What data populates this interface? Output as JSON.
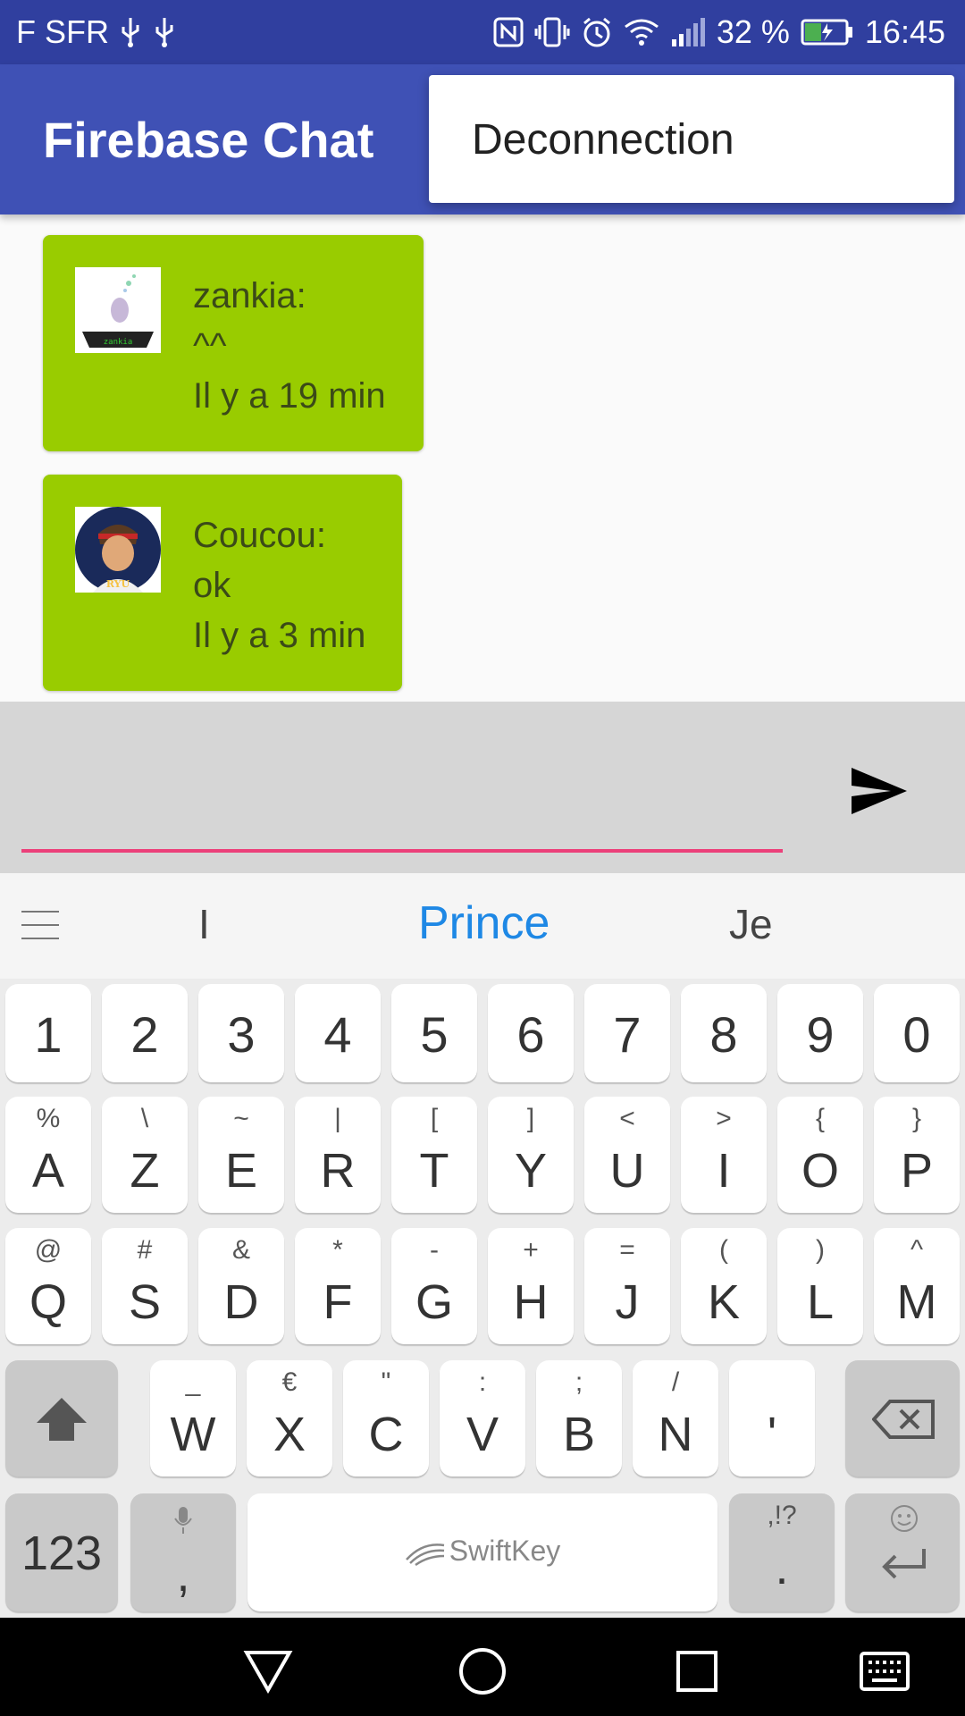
{
  "status_bar": {
    "carrier": "F SFR",
    "battery": "32 %",
    "time": "16:45",
    "icons": [
      "usb-icon",
      "usb-icon",
      "nfc-icon",
      "vibrate-icon",
      "alarm-icon",
      "wifi-icon",
      "signal-icon",
      "battery-icon"
    ]
  },
  "app_bar": {
    "title": "Firebase Chat"
  },
  "overflow_menu": {
    "items": [
      {
        "label": "Deconnection"
      }
    ]
  },
  "messages": [
    {
      "author": "zankia:",
      "text": "^^",
      "time": "Il y a 19 min",
      "avatar": "zankia-avatar"
    },
    {
      "author": "Coucou:",
      "text": "ok",
      "time": "Il y a 3 min",
      "avatar": "ryu-avatar"
    }
  ],
  "input": {
    "value": "",
    "placeholder": ""
  },
  "colors": {
    "primary": "#3f51b5",
    "primary_dark": "#303f9f",
    "message_bg": "#99cc00",
    "accent": "#ec407a"
  },
  "keyboard": {
    "suggestions": [
      "I",
      "Prince",
      "Je"
    ],
    "row_numbers": [
      "1",
      "2",
      "3",
      "4",
      "5",
      "6",
      "7",
      "8",
      "9",
      "0"
    ],
    "row1": [
      {
        "k": "A",
        "a": "%"
      },
      {
        "k": "Z",
        "a": "\\"
      },
      {
        "k": "E",
        "a": "~"
      },
      {
        "k": "R",
        "a": "|"
      },
      {
        "k": "T",
        "a": "["
      },
      {
        "k": "Y",
        "a": "]"
      },
      {
        "k": "U",
        "a": "<"
      },
      {
        "k": "I",
        "a": ">"
      },
      {
        "k": "O",
        "a": "{"
      },
      {
        "k": "P",
        "a": "}"
      }
    ],
    "row2": [
      {
        "k": "Q",
        "a": "@"
      },
      {
        "k": "S",
        "a": "#"
      },
      {
        "k": "D",
        "a": "&"
      },
      {
        "k": "F",
        "a": "*"
      },
      {
        "k": "G",
        "a": "-"
      },
      {
        "k": "H",
        "a": "+"
      },
      {
        "k": "J",
        "a": "="
      },
      {
        "k": "K",
        "a": "("
      },
      {
        "k": "L",
        "a": ")"
      },
      {
        "k": "M",
        "a": "^"
      }
    ],
    "row3": [
      {
        "k": "W",
        "a": "_"
      },
      {
        "k": "X",
        "a": "€"
      },
      {
        "k": "C",
        "a": "\""
      },
      {
        "k": "V",
        "a": ":"
      },
      {
        "k": "B",
        "a": ";"
      },
      {
        "k": "N",
        "a": "/"
      },
      {
        "k": "'",
        "a": ""
      }
    ],
    "numbers_key": "123",
    "comma_key": ",",
    "space_label": "SwiftKey",
    "period_key": ".",
    "period_alt": ",!?"
  }
}
